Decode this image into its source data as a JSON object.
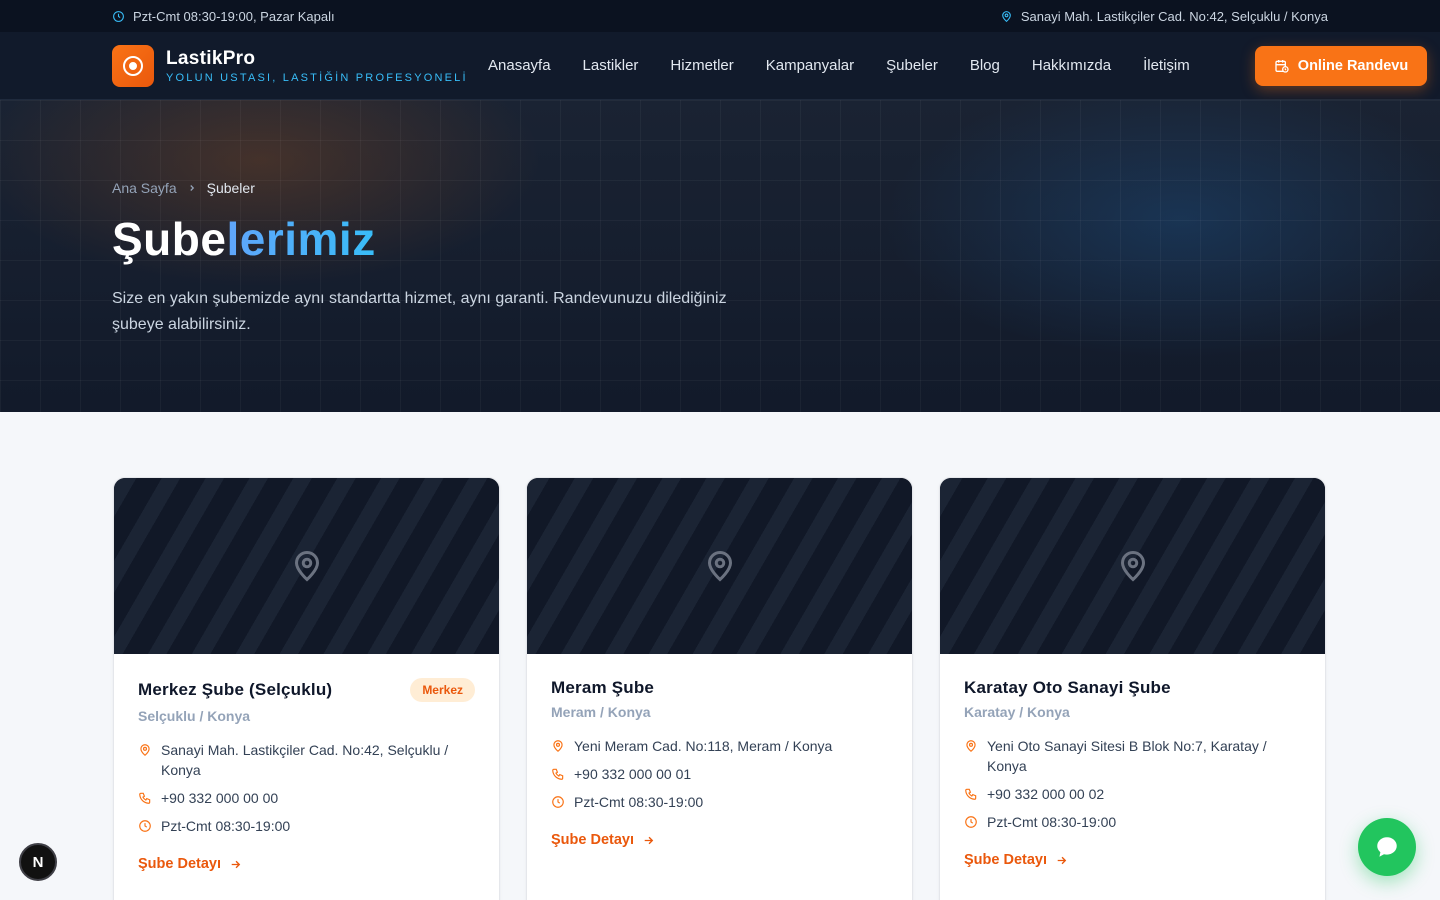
{
  "topbar": {
    "hours": "Pzt-Cmt 08:30-19:00, Pazar Kapalı",
    "address": "Sanayi Mah. Lastikçiler Cad. No:42, Selçuklu / Konya"
  },
  "brand": {
    "name": "LastikPro",
    "tagline": "YOLUN USTASI, LASTİĞİN PROFESYONELİ"
  },
  "nav": {
    "items": [
      "Anasayfa",
      "Lastikler",
      "Hizmetler",
      "Kampanyalar",
      "Şubeler",
      "Blog",
      "Hakkımızda",
      "İletişim"
    ]
  },
  "cta": {
    "label": "Online Randevu"
  },
  "hero": {
    "breadcrumb": {
      "home": "Ana Sayfa",
      "current": "Şubeler"
    },
    "title_main": "Şube",
    "title_accent": "lerimiz",
    "description": "Size en yakın şubemizde aynı standartta hizmet, aynı garanti. Randevunuzu dilediğiniz şubeye alabilirsiniz."
  },
  "branches": [
    {
      "name": "Merkez Şube (Selçuklu)",
      "badge": "Merkez",
      "district": "Selçuklu / Konya",
      "address": "Sanayi Mah. Lastikçiler Cad. No:42, Selçuklu / Konya",
      "phone": "+90 332 000 00 00",
      "hours": "Pzt-Cmt 08:30-19:00",
      "link": "Şube Detayı"
    },
    {
      "name": "Meram Şube",
      "badge": "",
      "district": "Meram / Konya",
      "address": "Yeni Meram Cad. No:118, Meram / Konya",
      "phone": "+90 332 000 00 01",
      "hours": "Pzt-Cmt 08:30-19:00",
      "link": "Şube Detayı"
    },
    {
      "name": "Karatay Oto Sanayi Şube",
      "badge": "",
      "district": "Karatay / Konya",
      "address": "Yeni Oto Sanayi Sitesi B Blok No:7, Karatay / Konya",
      "phone": "+90 332 000 00 02",
      "hours": "Pzt-Cmt 08:30-19:00",
      "link": "Şube Detayı"
    }
  ],
  "floating": {
    "next_badge": "N"
  },
  "colors": {
    "accent": "#f97316",
    "brand_blue": "#38bdf8",
    "chat": "#22c55e",
    "dark": "#111a2b"
  }
}
